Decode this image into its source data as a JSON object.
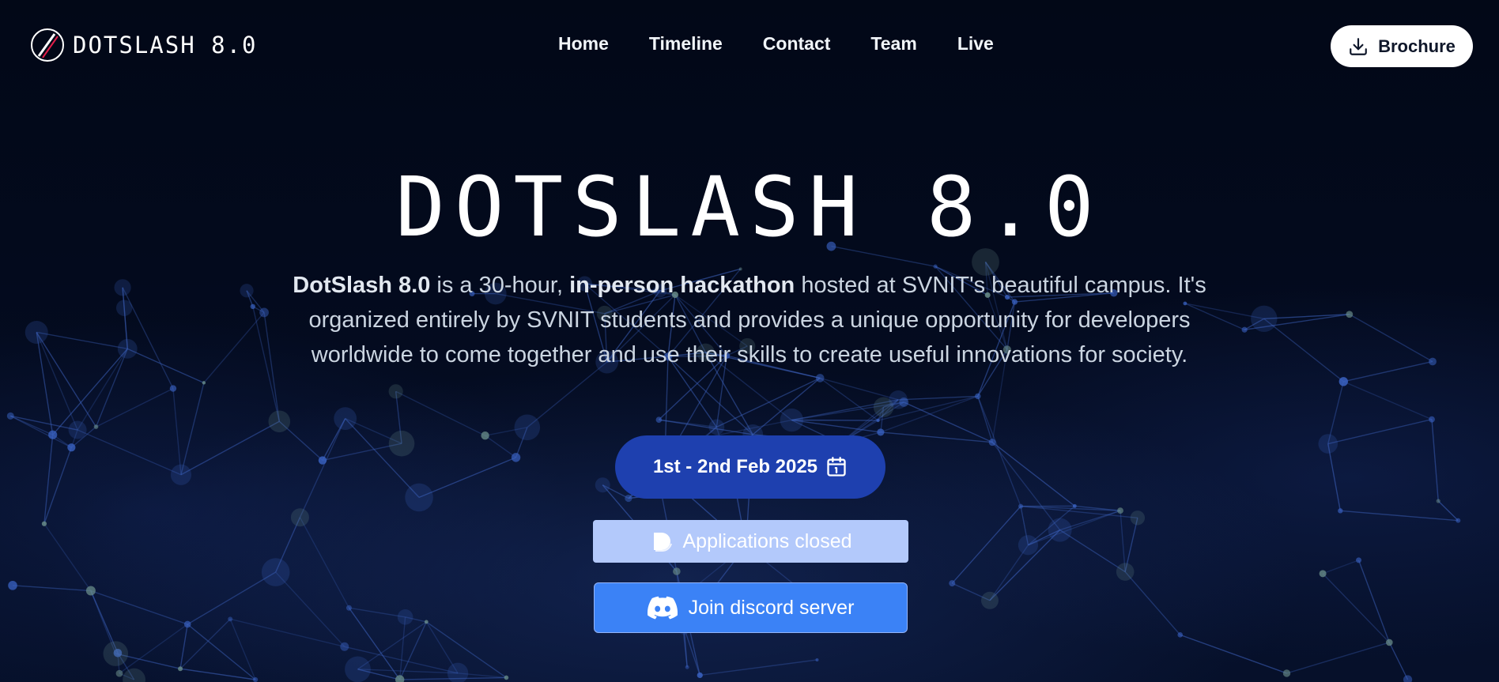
{
  "header": {
    "logo_text": "DOTSLASH 8.0",
    "nav": [
      {
        "label": "Home"
      },
      {
        "label": "Timeline"
      },
      {
        "label": "Contact"
      },
      {
        "label": "Team"
      },
      {
        "label": "Live"
      }
    ],
    "brochure": {
      "label": "Brochure",
      "icon": "download-icon"
    }
  },
  "hero": {
    "title": "DOTSLASH 8.0",
    "description": {
      "part1_bold": "DotSlash 8.0",
      "part2": " is a 30-hour, ",
      "part3_bold": "in-person hackathon",
      "part4": " hosted at SVNIT's beautiful campus. It's organized entirely by SVNIT students and provides a unique opportunity for developers worldwide to come together and use their skills to create useful innovations for society."
    },
    "date": {
      "label": "1st - 2nd Feb 2025",
      "icon": "calendar-icon"
    },
    "applications": {
      "label": "Applications closed",
      "icon": "devfolio-icon"
    },
    "discord": {
      "label": "Join discord server",
      "icon": "discord-icon"
    }
  },
  "colors": {
    "background": "#020817",
    "date_pill": "#1e40af",
    "applications_button": "#b3c9fb",
    "discord_button": "#3b82f6"
  }
}
